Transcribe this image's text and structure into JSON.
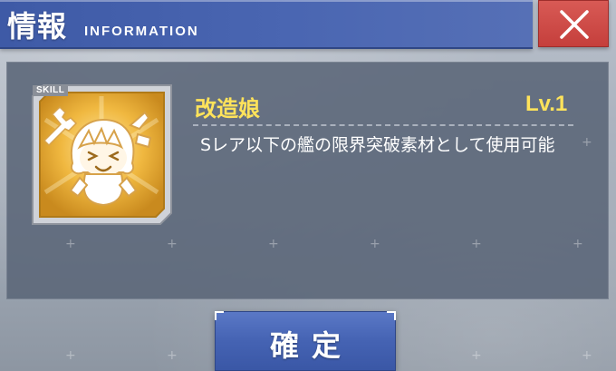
{
  "header": {
    "title": "情報",
    "subtitle": "INFORMATION"
  },
  "close_button": {
    "icon": "close-icon"
  },
  "skill": {
    "tag": "SKILL",
    "icon": "wrench-chibi-icon",
    "name": "改造娘",
    "level": "Lv.1",
    "description": "Sレア以下の艦の限界突破素材として使用可能"
  },
  "confirm_button": {
    "label": "確定"
  },
  "colors": {
    "header_blue": "#4a66b2",
    "close_red": "#c53f3c",
    "skill_yellow": "#ffe35a",
    "panel": "#5a6578",
    "icon_gold": "#e0a52a"
  }
}
